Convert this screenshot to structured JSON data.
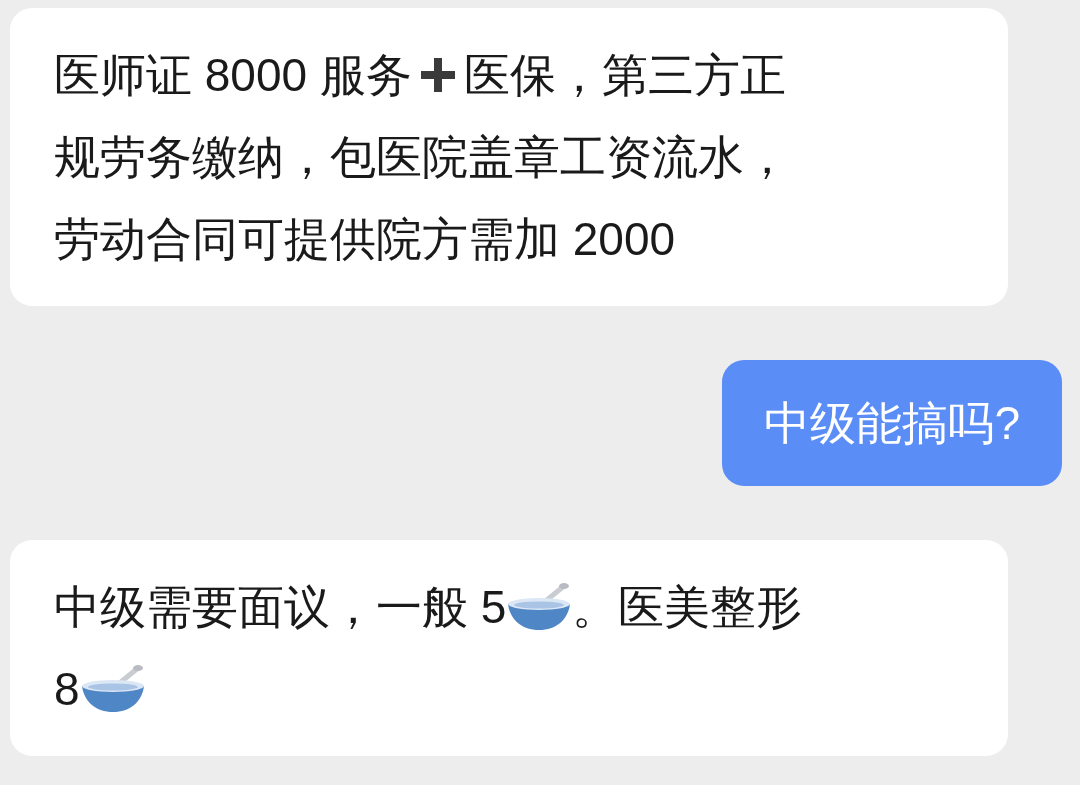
{
  "messages": [
    {
      "outgoing": false,
      "lines": [
        [
          {
            "kind": "text",
            "text": "医师证 8000 服务"
          },
          {
            "kind": "plus"
          },
          {
            "kind": "text",
            "text": "医保，第三方正"
          }
        ],
        [
          {
            "kind": "text",
            "text": "规劳务缴纳，包医院盖章工资流水，"
          }
        ],
        [
          {
            "kind": "text",
            "text": "劳动合同可提供院方需加 2000"
          }
        ]
      ]
    },
    {
      "outgoing": true,
      "lines": [
        [
          {
            "kind": "text",
            "text": "中级能搞吗?"
          }
        ]
      ]
    },
    {
      "outgoing": false,
      "lines": [
        [
          {
            "kind": "text",
            "text": "中级需要面议，一般 5"
          },
          {
            "kind": "bowl"
          },
          {
            "kind": "text",
            "text": "。医美整形"
          }
        ],
        [
          {
            "kind": "text",
            "text": "8"
          },
          {
            "kind": "bowl"
          }
        ]
      ]
    }
  ]
}
